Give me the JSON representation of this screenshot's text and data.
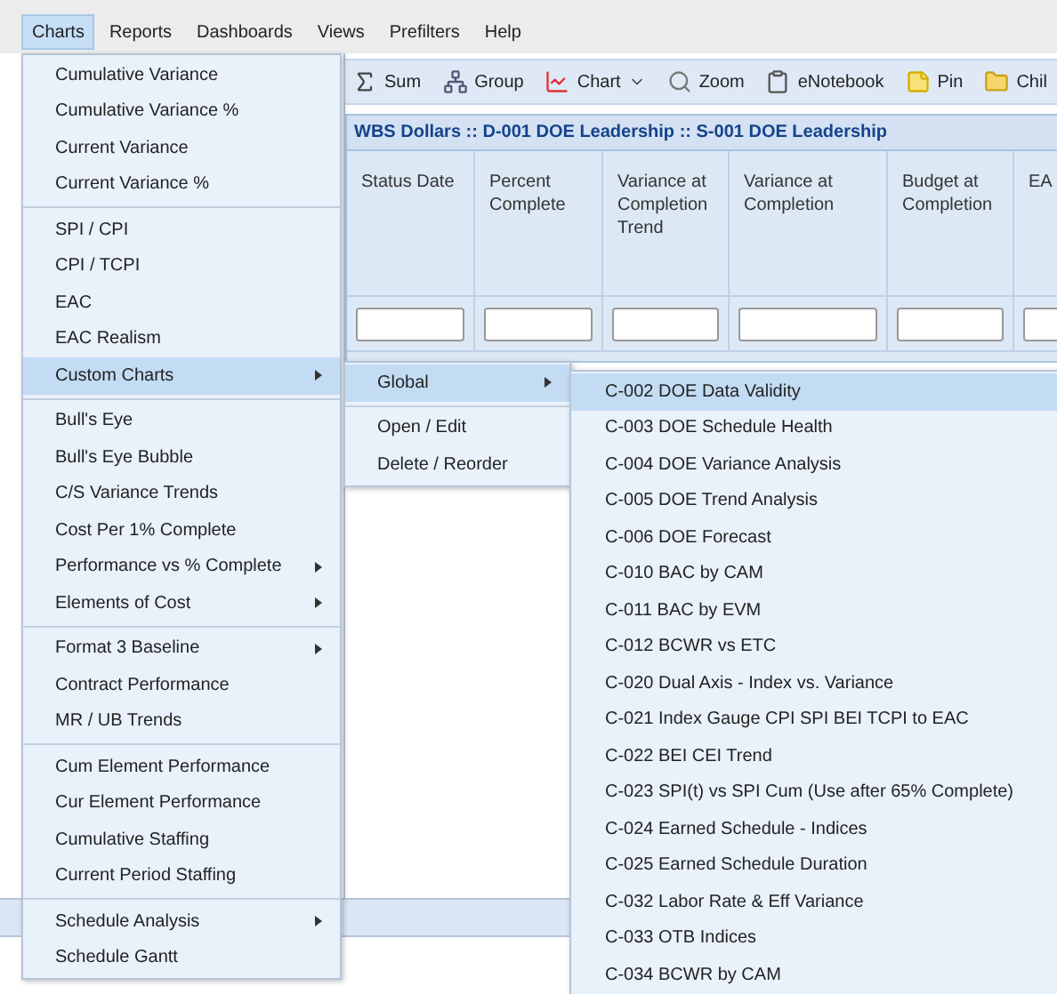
{
  "menubar": [
    {
      "label": "Charts",
      "selected": true
    },
    {
      "label": "Reports",
      "selected": false
    },
    {
      "label": "Dashboards",
      "selected": false
    },
    {
      "label": "Views",
      "selected": false
    },
    {
      "label": "Prefilters",
      "selected": false
    },
    {
      "label": "Help",
      "selected": false
    }
  ],
  "toolbar": [
    {
      "label": "Sum",
      "kind": "sum",
      "dropdown": false
    },
    {
      "label": "Group",
      "kind": "group",
      "dropdown": false
    },
    {
      "label": "Chart",
      "kind": "chart",
      "dropdown": true
    },
    {
      "label": "Zoom",
      "kind": "zoom",
      "dropdown": false
    },
    {
      "label": "eNotebook",
      "kind": "notebook",
      "dropdown": false
    },
    {
      "label": "Pin",
      "kind": "pin",
      "dropdown": false
    },
    {
      "label": "Chil",
      "kind": "child",
      "dropdown": false
    }
  ],
  "grid": {
    "title": "WBS Dollars :: D-001 DOE Leadership :: S-001 DOE Leadership",
    "columns": [
      "Status Date",
      "Percent Complete",
      "Variance at Completion Trend",
      "Variance at Completion",
      "Budget at Completion",
      "EA"
    ]
  },
  "charts_menu": [
    {
      "items": [
        {
          "label": "Cumulative Variance",
          "selected": false,
          "submenu": false
        },
        {
          "label": "Cumulative Variance %",
          "selected": false,
          "submenu": false
        },
        {
          "label": "Current Variance",
          "selected": false,
          "submenu": false
        },
        {
          "label": "Current Variance %",
          "selected": false,
          "submenu": false
        }
      ]
    },
    {
      "items": [
        {
          "label": "SPI / CPI",
          "selected": false,
          "submenu": false
        },
        {
          "label": "CPI / TCPI",
          "selected": false,
          "submenu": false
        },
        {
          "label": "EAC",
          "selected": false,
          "submenu": false
        },
        {
          "label": "EAC Realism",
          "selected": false,
          "submenu": false
        },
        {
          "label": "Custom Charts",
          "selected": true,
          "submenu": true
        }
      ]
    },
    {
      "items": [
        {
          "label": "Bull's Eye",
          "selected": false,
          "submenu": false
        },
        {
          "label": "Bull's Eye Bubble",
          "selected": false,
          "submenu": false
        },
        {
          "label": "C/S Variance Trends",
          "selected": false,
          "submenu": false
        },
        {
          "label": "Cost Per 1% Complete",
          "selected": false,
          "submenu": false
        },
        {
          "label": "Performance vs % Complete",
          "selected": false,
          "submenu": true
        },
        {
          "label": "Elements of Cost",
          "selected": false,
          "submenu": true
        }
      ]
    },
    {
      "items": [
        {
          "label": "Format 3 Baseline",
          "selected": false,
          "submenu": true
        },
        {
          "label": "Contract Performance",
          "selected": false,
          "submenu": false
        },
        {
          "label": "MR / UB Trends",
          "selected": false,
          "submenu": false
        }
      ]
    },
    {
      "items": [
        {
          "label": "Cum Element Performance",
          "selected": false,
          "submenu": false
        },
        {
          "label": "Cur Element Performance",
          "selected": false,
          "submenu": false
        },
        {
          "label": "Cumulative Staffing",
          "selected": false,
          "submenu": false
        },
        {
          "label": "Current Period Staffing",
          "selected": false,
          "submenu": false
        }
      ]
    },
    {
      "items": [
        {
          "label": "Schedule Analysis",
          "selected": false,
          "submenu": true
        },
        {
          "label": "Schedule Gantt",
          "selected": false,
          "submenu": false
        }
      ]
    }
  ],
  "custom_charts_menu": [
    {
      "items": [
        {
          "label": "Global",
          "selected": true,
          "submenu": true
        }
      ]
    },
    {
      "items": [
        {
          "label": "Open / Edit",
          "selected": false,
          "submenu": false
        },
        {
          "label": "Delete / Reorder",
          "selected": false,
          "submenu": false
        }
      ]
    }
  ],
  "global_menu": [
    {
      "items": [
        {
          "label": "C-002 DOE Data Validity",
          "selected": true
        },
        {
          "label": "C-003 DOE Schedule Health",
          "selected": false
        },
        {
          "label": "C-004 DOE Variance Analysis",
          "selected": false
        },
        {
          "label": "C-005 DOE Trend Analysis",
          "selected": false
        },
        {
          "label": "C-006 DOE Forecast",
          "selected": false
        },
        {
          "label": "C-010 BAC by CAM",
          "selected": false
        },
        {
          "label": "C-011 BAC by EVM",
          "selected": false
        },
        {
          "label": "C-012 BCWR vs ETC",
          "selected": false
        },
        {
          "label": "C-020 Dual Axis - Index vs. Variance",
          "selected": false
        },
        {
          "label": "C-021 Index Gauge CPI SPI BEI TCPI to EAC",
          "selected": false
        },
        {
          "label": "C-022 BEI CEI Trend",
          "selected": false
        },
        {
          "label": "C-023 SPI(t) vs SPI Cum (Use after 65% Complete)",
          "selected": false
        },
        {
          "label": "C-024 Earned Schedule - Indices",
          "selected": false
        },
        {
          "label": "C-025 Earned Schedule Duration",
          "selected": false
        },
        {
          "label": "C-032 Labor Rate & Eff Variance",
          "selected": false
        },
        {
          "label": "C-033 OTB Indices",
          "selected": false
        },
        {
          "label": "C-034 BCWR by CAM",
          "selected": false
        }
      ]
    }
  ]
}
